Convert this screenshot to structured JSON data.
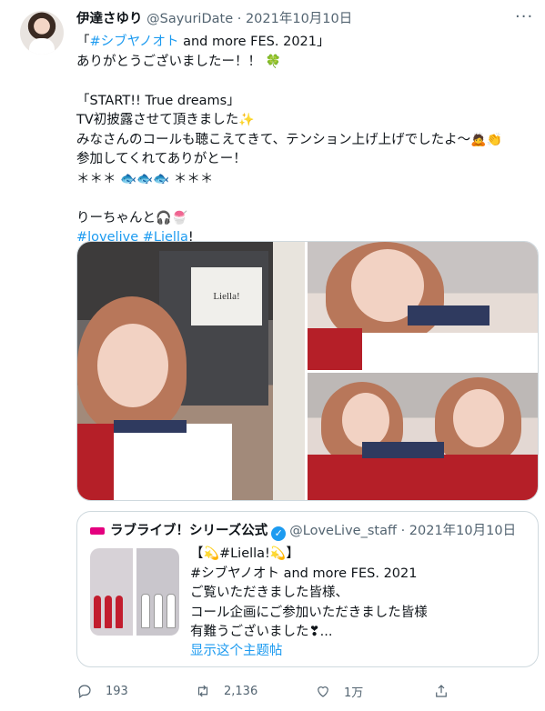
{
  "author": {
    "name": "伊達さゆり",
    "handle": "@SayuriDate",
    "separator": "·",
    "date": "2021年10月10日"
  },
  "more_label": "···",
  "body": {
    "line1_pre": "「",
    "line1_hashtag": "#シブヤノオト",
    "line1_post": " and more FES. 2021」",
    "line2": "ありがとうございましたー！！",
    "line3": "「START!! True dreams」",
    "line4": "TV初披露させて頂きました",
    "line5": "みなさんのコールも聴こえてきて、テンション上げ上げでしたよ〜",
    "line6": "参加してくれてありがとー！",
    "line7": "＊＊＊ 🐟🐟🐟 ＊＊＊",
    "line8": "りーちゃんと",
    "tag1": "#lovelive",
    "tag2": "#Liella",
    "tag2_suffix": "!"
  },
  "media": {
    "sign_text": "Liella!"
  },
  "quote": {
    "name": "ラブライブ！シリーズ公式",
    "verified": "✓",
    "handle": "@LoveLive_staff",
    "separator": "·",
    "date": "2021年10月10日",
    "line1_pre": "【",
    "line1_tag": "#Liella!",
    "line1_post": "】",
    "line2": "#シブヤノオト and more FES. 2021",
    "line3": "ご覧いただきました皆様、",
    "line4": "コール企画にご参加いただきました皆様",
    "line5": "有難うございました❣...",
    "show_thread": "显示这个主题帖"
  },
  "actions": {
    "reply_count": "193",
    "retweet_count": "2,136",
    "like_count": "1万",
    "share_label": ""
  },
  "colors": {
    "link": "#1d9bf0",
    "text": "#0f1419",
    "muted": "#536471",
    "border": "#cfd9de"
  }
}
